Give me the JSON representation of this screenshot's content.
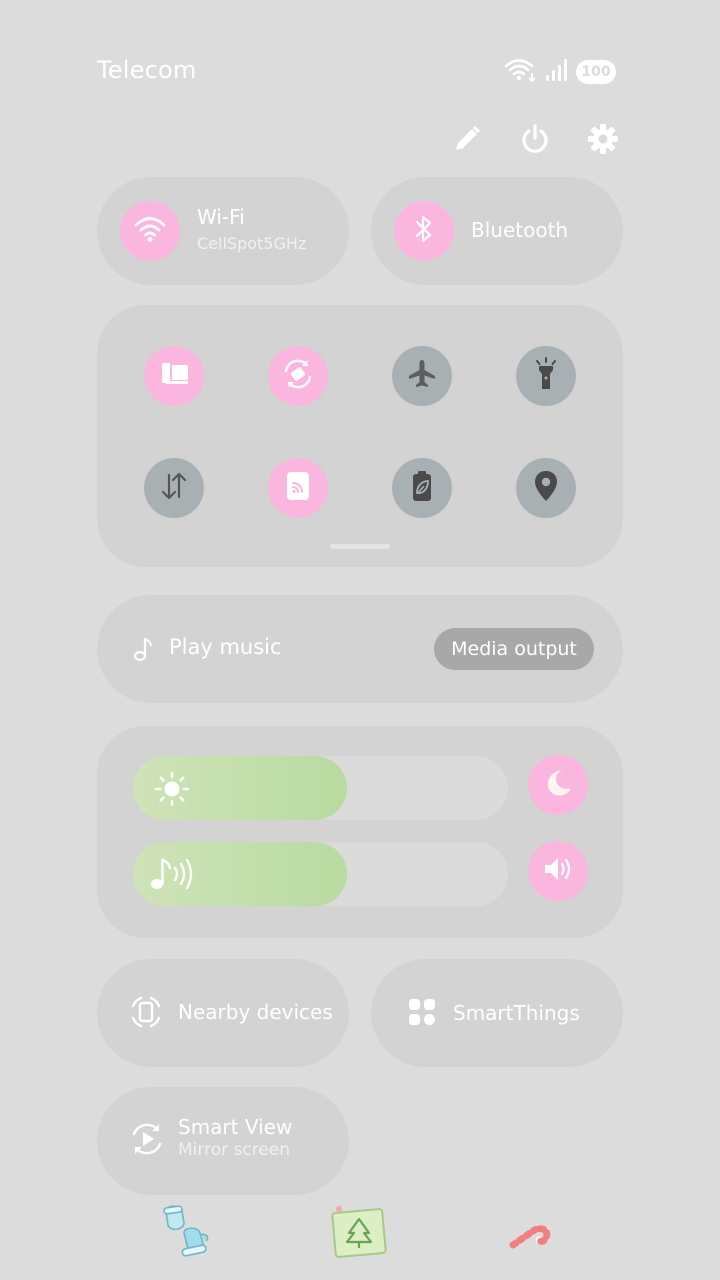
{
  "status_bar": {
    "carrier": "Telecom",
    "battery_level": "100",
    "icons": [
      "wifi-icon",
      "signal-icon"
    ]
  },
  "toolbar": {
    "icons": [
      "pencil-icon",
      "power-icon",
      "gear-icon"
    ]
  },
  "connectivity": {
    "wifi": {
      "label": "Wi-Fi",
      "network": "CellSpot5GHz",
      "active": true
    },
    "bluetooth": {
      "label": "Bluetooth",
      "active": true
    }
  },
  "quick_toggles": [
    {
      "icon": "screen-share-icon",
      "active": true
    },
    {
      "icon": "auto-rotate-icon",
      "active": true
    },
    {
      "icon": "airplane-icon",
      "active": false
    },
    {
      "icon": "flashlight-icon",
      "active": false
    },
    {
      "icon": "mobile-data-icon",
      "active": false
    },
    {
      "icon": "cast-icon",
      "active": true
    },
    {
      "icon": "power-saving-icon",
      "active": false
    },
    {
      "icon": "location-icon",
      "active": false
    }
  ],
  "media": {
    "play_label": "Play music",
    "output_label": "Media output"
  },
  "sliders": {
    "brightness_level": 0.57,
    "volume_level": 0.57
  },
  "accent_pink": "#fbb6e0",
  "accent_green": "#b8dba0",
  "bottom_tiles": {
    "nearby": "Nearby devices",
    "smartthings": "SmartThings",
    "smartview_title": "Smart View",
    "smartview_sub": "Mirror screen"
  }
}
